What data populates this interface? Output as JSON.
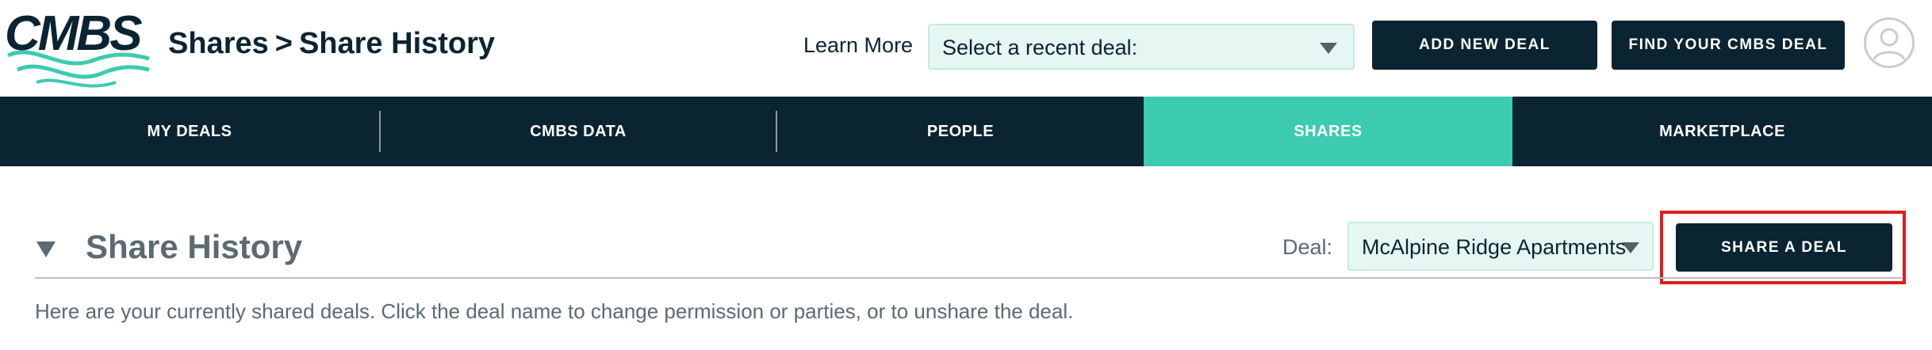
{
  "header": {
    "logo_text": "CMBS",
    "breadcrumb": {
      "parent": "Shares",
      "separator": ">",
      "current": "Share History"
    },
    "learn_more": "Learn More",
    "recent_deal_select": {
      "value": "Select a recent deal:"
    },
    "add_new_deal_label": "ADD NEW DEAL",
    "find_deal_label": "FIND YOUR CMBS DEAL"
  },
  "nav": {
    "items": [
      {
        "label": "MY DEALS"
      },
      {
        "label": "CMBS DATA"
      },
      {
        "label": "PEOPLE"
      },
      {
        "label": "SHARES"
      },
      {
        "label": "MARKETPLACE"
      }
    ],
    "active": "SHARES"
  },
  "section": {
    "title": "Share History",
    "deal_label": "Deal:",
    "deal_value": "McAlpine Ridge Apartments",
    "share_button_label": "SHARE A DEAL",
    "description": "Here are your currently shared deals. Click the deal name to change permission or parties, or to unshare the deal."
  },
  "colors": {
    "navy": "#0b2432",
    "teal": "#3ccbb0",
    "select_bg": "#e6f7f3",
    "highlight": "#e21b1b",
    "muted_text": "#5b6a73"
  },
  "icons": {
    "section_toggle": "triangle-down-icon",
    "select_caret": "caret-down-icon",
    "avatar": "user-avatar-icon"
  }
}
